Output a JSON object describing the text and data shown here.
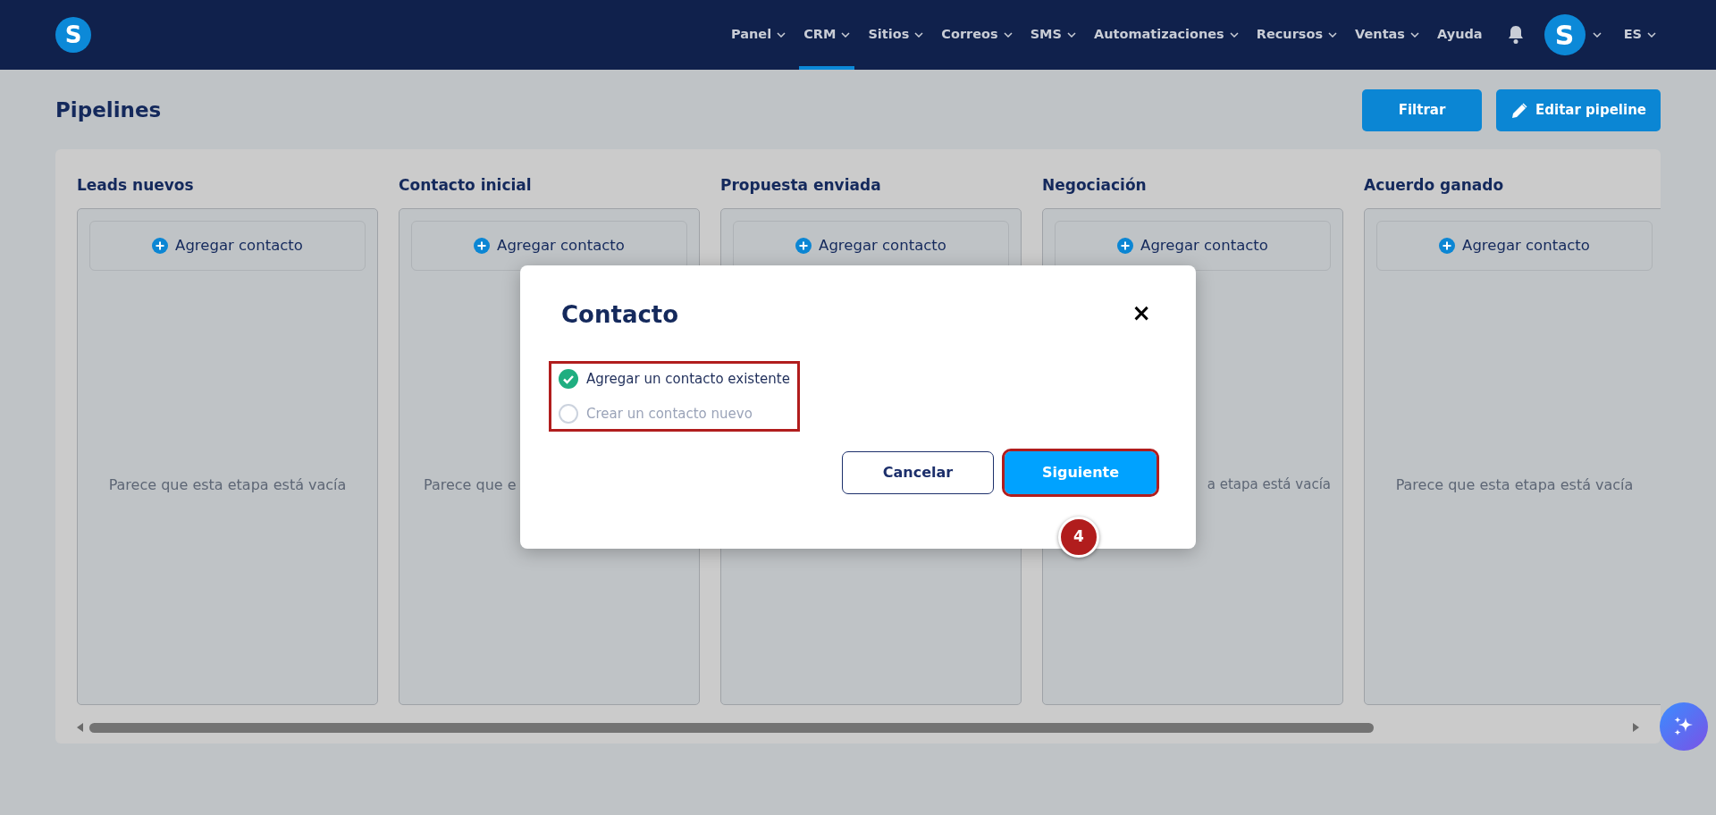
{
  "navbar": {
    "logo": "S",
    "items": [
      {
        "label": "Panel",
        "selected": false,
        "dropdown": true
      },
      {
        "label": "CRM",
        "selected": true,
        "dropdown": true
      },
      {
        "label": "Sitios",
        "selected": false,
        "dropdown": true
      },
      {
        "label": "Correos",
        "selected": false,
        "dropdown": true
      },
      {
        "label": "SMS",
        "selected": false,
        "dropdown": true
      },
      {
        "label": "Automatizaciones",
        "selected": false,
        "dropdown": true
      },
      {
        "label": "Recursos",
        "selected": false,
        "dropdown": true
      },
      {
        "label": "Ventas",
        "selected": false,
        "dropdown": true
      },
      {
        "label": "Ayuda",
        "selected": false,
        "dropdown": false
      }
    ],
    "avatar": "S",
    "language": "ES"
  },
  "page": {
    "title": "Pipelines",
    "buttons": [
      {
        "label": "Filtrar",
        "kind": "plain"
      },
      {
        "label": "Editar pipeline",
        "kind": "edit"
      }
    ]
  },
  "stages": [
    {
      "title": "Leads nuevos",
      "add_label": "Agregar contacto",
      "empty_text": "Parece que esta etapa está vacía"
    },
    {
      "title": "Contacto inicial",
      "add_label": "Agregar contacto",
      "empty_text_start": "Parece que e"
    },
    {
      "title": "Propuesta enviada",
      "add_label": "Agregar contacto"
    },
    {
      "title": "Negociación",
      "add_label": "Agregar contacto",
      "empty_text_end": "a etapa está vacía"
    },
    {
      "title": "Acuerdo ganado",
      "add_label": "Agregar contacto",
      "empty_text": "Parece que esta etapa está vacía"
    }
  ],
  "modal": {
    "title": "Contacto",
    "close": "×",
    "options_highlighted": true,
    "options": [
      {
        "label": "Agregar un contacto existente",
        "selected": true
      },
      {
        "label": "Crear un contacto nuevo",
        "selected": false
      }
    ],
    "buttons": [
      {
        "label": "Cancelar",
        "kind": "secondary",
        "highlighted": false
      },
      {
        "label": "Siguiente",
        "kind": "primary",
        "highlighted": true
      }
    ],
    "step_badge": "4"
  }
}
